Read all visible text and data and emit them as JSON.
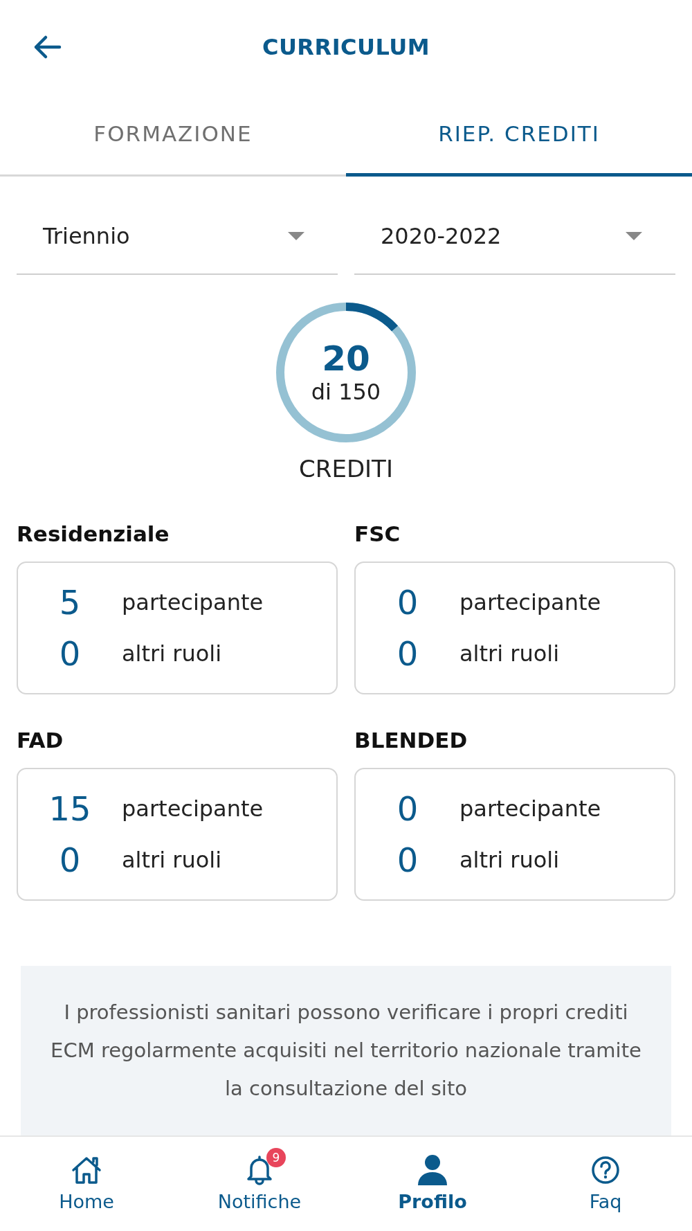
{
  "header": {
    "title": "CURRICULUM"
  },
  "tabs": [
    {
      "label": "FORMAZIONE",
      "selected": false
    },
    {
      "label": "RIEP. CREDITI",
      "selected": true
    }
  ],
  "filters": [
    {
      "value": "Triennio"
    },
    {
      "value": "2020-2022"
    }
  ],
  "credits": {
    "value": "20",
    "total": "di 150",
    "label": "CREDITI",
    "level": 0.133
  },
  "categories": [
    {
      "title": "Residenziale",
      "rows": [
        {
          "value": "5",
          "label": "partecipante"
        },
        {
          "value": "0",
          "label": "altri ruoli"
        }
      ]
    },
    {
      "title": "FSC",
      "rows": [
        {
          "value": "0",
          "label": "partecipante"
        },
        {
          "value": "0",
          "label": "altri ruoli"
        }
      ]
    },
    {
      "title": "FAD",
      "rows": [
        {
          "value": "15",
          "label": "partecipante"
        },
        {
          "value": "0",
          "label": "altri ruoli"
        }
      ]
    },
    {
      "title": "BLENDED",
      "rows": [
        {
          "value": "0",
          "label": "partecipante"
        },
        {
          "value": "0",
          "label": "altri ruoli"
        }
      ]
    }
  ],
  "info": {
    "text": "I professionisti sanitari possono verificare i propri crediti ECM regolarmente acquisiti nel territorio nazionale tramite la consultazione del sito"
  },
  "nav": [
    {
      "kind": "home",
      "label": "Home",
      "selected": false
    },
    {
      "kind": "bell",
      "label": "Notifiche",
      "selected": false,
      "badge": "9"
    },
    {
      "kind": "person",
      "label": "Profilo",
      "selected": true
    },
    {
      "kind": "help",
      "label": "Faq",
      "selected": false
    }
  ]
}
